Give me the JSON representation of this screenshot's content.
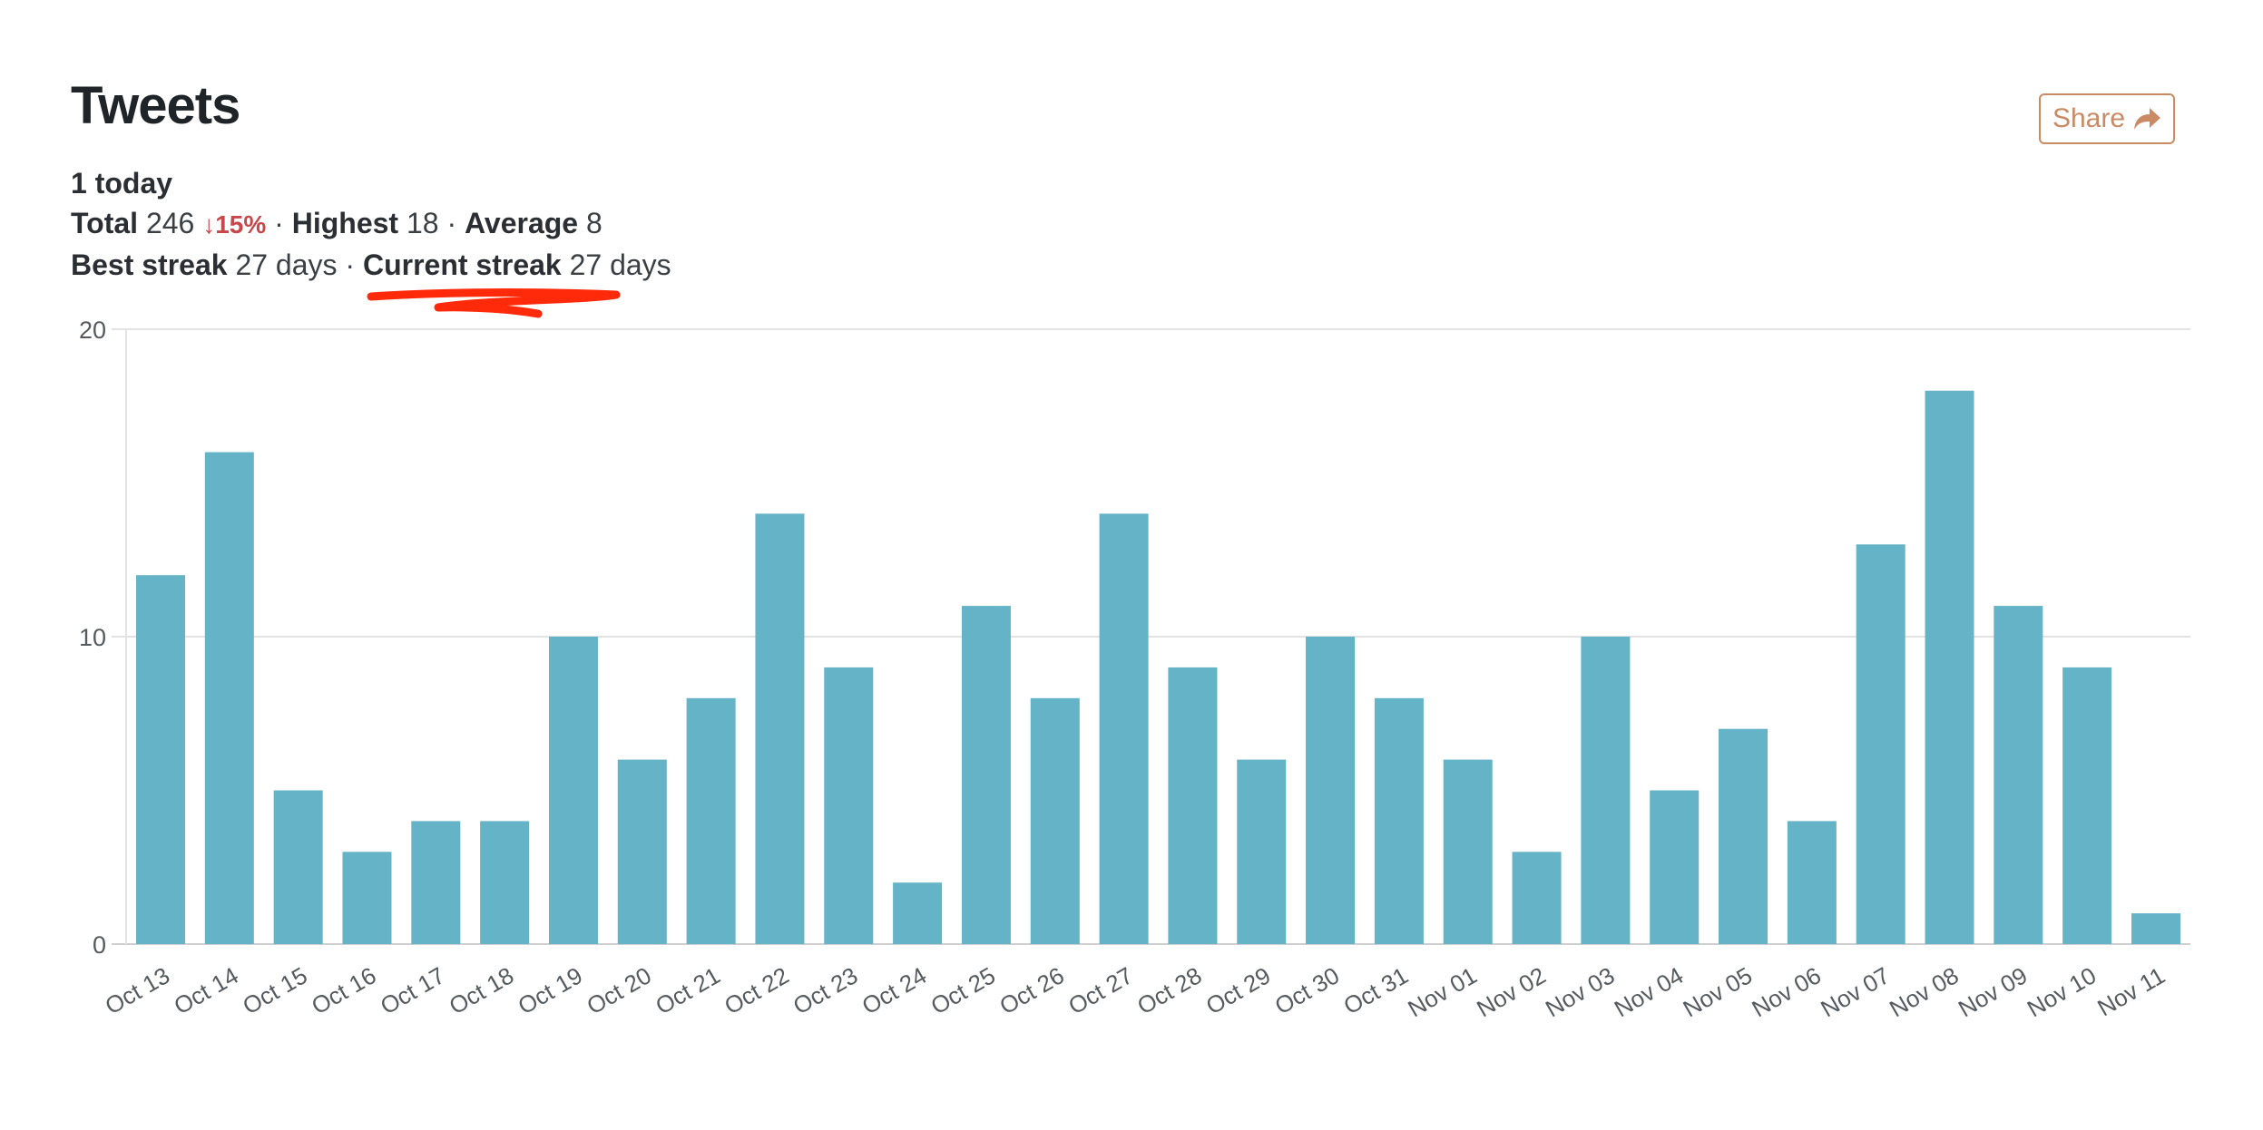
{
  "header": {
    "title": "Tweets",
    "share_label": "Share",
    "share_icon": "share-arrow-icon"
  },
  "stats": {
    "today_value": "1",
    "today_label": "today",
    "total_label": "Total",
    "total_value": "246",
    "change": "↓15%",
    "highest_label": "Highest",
    "highest_value": "18",
    "average_label": "Average",
    "average_value": "8",
    "best_streak_label": "Best streak",
    "best_streak_value": "27 days",
    "current_streak_label": "Current streak",
    "current_streak_value": "27 days",
    "separator": "·"
  },
  "colors": {
    "bar": "#64b3c6",
    "accent": "#c98a64",
    "negative": "#c9474b",
    "annotation": "#ff2a0a"
  },
  "chart_data": {
    "type": "bar",
    "title": "Tweets",
    "xlabel": "",
    "ylabel": "",
    "ylim": [
      0,
      20
    ],
    "yticks": [
      0,
      10,
      20
    ],
    "grid": true,
    "legend": "none",
    "categories": [
      "Oct 13",
      "Oct 14",
      "Oct 15",
      "Oct 16",
      "Oct 17",
      "Oct 18",
      "Oct 19",
      "Oct 20",
      "Oct 21",
      "Oct 22",
      "Oct 23",
      "Oct 24",
      "Oct 25",
      "Oct 26",
      "Oct 27",
      "Oct 28",
      "Oct 29",
      "Oct 30",
      "Oct 31",
      "Nov 01",
      "Nov 02",
      "Nov 03",
      "Nov 04",
      "Nov 05",
      "Nov 06",
      "Nov 07",
      "Nov 08",
      "Nov 09",
      "Nov 10",
      "Nov 11"
    ],
    "values": [
      12,
      16,
      5,
      3,
      4,
      4,
      10,
      6,
      8,
      14,
      9,
      2,
      11,
      8,
      14,
      9,
      6,
      10,
      8,
      6,
      3,
      10,
      5,
      7,
      4,
      13,
      18,
      11,
      9,
      1
    ]
  }
}
